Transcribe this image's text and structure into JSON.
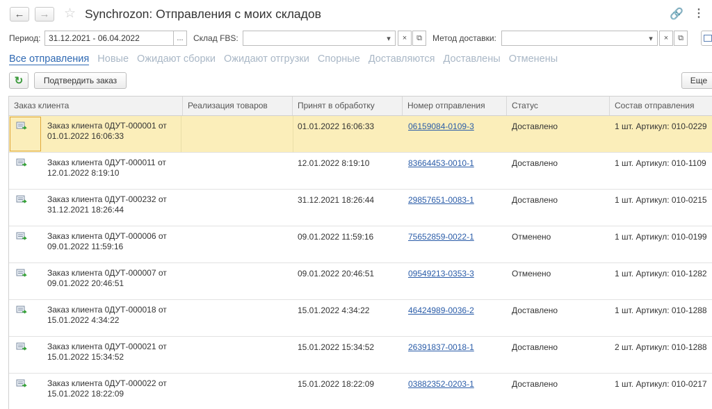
{
  "window": {
    "back_icon": "←",
    "forward_icon": "→",
    "star_icon": "☆",
    "title": "Synchrozon: Отправления с моих складов",
    "link_icon": "🔗",
    "more_icon": "⋮"
  },
  "filters": {
    "period_label": "Период:",
    "period_value": "31.12.2021 - 06.04.2022",
    "period_picker": "...",
    "warehouse_label": "Склад FBS:",
    "warehouse_value": "",
    "delivery_label": "Метод доставки:",
    "delivery_value": "",
    "dropdown_icon": "▾",
    "clear_icon": "×",
    "open_icon": "⧉"
  },
  "tabs": [
    {
      "label": "Все отправления"
    },
    {
      "label": "Новые"
    },
    {
      "label": "Ожидают сборки"
    },
    {
      "label": "Ожидают отгрузки"
    },
    {
      "label": "Спорные"
    },
    {
      "label": "Доставляются"
    },
    {
      "label": "Доставлены"
    },
    {
      "label": "Отменены"
    }
  ],
  "toolbar": {
    "refresh_icon": "↻",
    "confirm_label": "Подтвердить заказ",
    "more_label": "Еще"
  },
  "columns": {
    "order": "Заказ клиента",
    "realization": "Реализация товаров",
    "accepted": "Принят в обработку",
    "shipment_no": "Номер отправления",
    "status": "Статус",
    "composition": "Состав отправления"
  },
  "rows": [
    {
      "order_l1": "Заказ клиента 0ДУТ-000001 от",
      "order_l2": "01.01.2022 16:06:33",
      "accepted": "01.01.2022 16:06:33",
      "shipment_no": "06159084-0109-3",
      "status": "Доставлено",
      "composition": "1 шт. Артикул:  010-0229"
    },
    {
      "order_l1": "Заказ клиента 0ДУТ-000011 от",
      "order_l2": "12.01.2022 8:19:10",
      "accepted": "12.01.2022 8:19:10",
      "shipment_no": "83664453-0010-1",
      "status": "Доставлено",
      "composition": "1 шт. Артикул:  010-1109"
    },
    {
      "order_l1": "Заказ клиента 0ДУТ-000232 от",
      "order_l2": "31.12.2021 18:26:44",
      "accepted": "31.12.2021 18:26:44",
      "shipment_no": "29857651-0083-1",
      "status": "Доставлено",
      "composition": "1 шт. Артикул:  010-0215"
    },
    {
      "order_l1": "Заказ клиента 0ДУТ-000006 от",
      "order_l2": "09.01.2022 11:59:16",
      "accepted": "09.01.2022 11:59:16",
      "shipment_no": "75652859-0022-1",
      "status": "Отменено",
      "composition": "1 шт. Артикул:  010-0199"
    },
    {
      "order_l1": "Заказ клиента 0ДУТ-000007 от",
      "order_l2": "09.01.2022 20:46:51",
      "accepted": "09.01.2022 20:46:51",
      "shipment_no": "09549213-0353-3",
      "status": "Отменено",
      "composition": "1 шт. Артикул:  010-1282"
    },
    {
      "order_l1": "Заказ клиента 0ДУТ-000018 от",
      "order_l2": "15.01.2022 4:34:22",
      "accepted": "15.01.2022 4:34:22",
      "shipment_no": "46424989-0036-2",
      "status": "Доставлено",
      "composition": "1 шт. Артикул:  010-1288"
    },
    {
      "order_l1": "Заказ клиента 0ДУТ-000021 от",
      "order_l2": "15.01.2022 15:34:52",
      "accepted": "15.01.2022 15:34:52",
      "shipment_no": "26391837-0018-1",
      "status": "Доставлено",
      "composition": "2 шт. Артикул:  010-1288"
    },
    {
      "order_l1": "Заказ клиента 0ДУТ-000022 от",
      "order_l2": "15.01.2022 18:22:09",
      "accepted": "15.01.2022 18:22:09",
      "shipment_no": "03882352-0203-1",
      "status": "Доставлено",
      "composition": "1 шт. Артикул:  010-0217"
    }
  ]
}
